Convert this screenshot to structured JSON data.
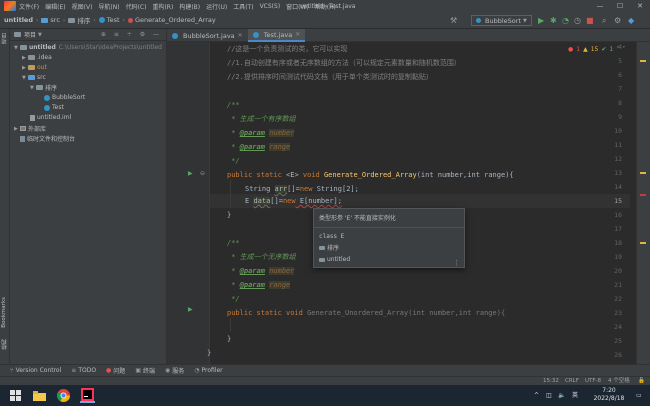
{
  "menubar": {
    "items": [
      "文件(F)",
      "编辑(E)",
      "视图(V)",
      "导航(N)",
      "代码(C)",
      "重构(R)",
      "构建(B)",
      "运行(U)",
      "工具(T)",
      "VCS(S)",
      "窗口(W)",
      "帮助(H)"
    ],
    "title": "untitled - Test.java",
    "min": "—",
    "max": "☐",
    "close": "✕"
  },
  "navbar": {
    "crumbs": [
      "untitled",
      "src",
      "排序",
      "Test",
      "Generate_Ordered_Array"
    ],
    "run_config": "BubbleSort"
  },
  "project": {
    "header": "项目",
    "tree": [
      {
        "label": "untitled",
        "hint": "C:\\Users\\Star\\IdeaProjects\\untitled"
      },
      {
        "label": ".idea"
      },
      {
        "label": "out"
      },
      {
        "label": "src"
      },
      {
        "label": "排序"
      },
      {
        "label": "BubbleSort"
      },
      {
        "label": "Test"
      },
      {
        "label": "untitled.iml"
      },
      {
        "label": "外部库"
      },
      {
        "label": "临时文件和控制台"
      }
    ]
  },
  "left_stripe": {
    "project": "项目",
    "bookmarks": "Bookmarks",
    "structure": "结构"
  },
  "tabs": [
    {
      "label": "BubbleSort.java",
      "active": false
    },
    {
      "label": "Test.java",
      "active": true
    }
  ],
  "inspections": {
    "errors": "1",
    "warnings": "15",
    "ok": "1"
  },
  "editor": {
    "line_numbers": [
      "4",
      "5",
      "6",
      "7",
      "8",
      "9",
      "10",
      "11",
      "12",
      "13",
      "14",
      "15",
      "16",
      "17",
      "18",
      "19",
      "20",
      "21",
      "22",
      "23",
      "24",
      "25",
      "26"
    ],
    "current_line": "15",
    "lines": {
      "l4": "//这是一个负责测试的类，它可以实现",
      "l5": "//1.自动创建有序或者无序数组的方法（可以规定元素数量和随机数范围）",
      "l6": "//2.提供排序时间测试代码文档（用于单个类测试时的复制黏贴）",
      "l8": "/**",
      "l9": " * 生成一个有序数组",
      "l10_tag": "@param",
      "l10_val": "number",
      "l11_tag": "@param",
      "l11_val": "range",
      "l12": " */",
      "l13_kw": "public static",
      "l13_gen": "<E>",
      "l13_void": "void",
      "l13_fn": "Generate_Ordered_Array",
      "l13_params": "(int number,int range){",
      "l14_a": "String",
      "l14_var": "arr",
      "l14_b": "[]=",
      "l14_new": "new",
      "l14_c": " String[2];",
      "l15_a": "E",
      "l15_var": "data",
      "l15_b": "[]=",
      "l15_new": "new",
      "l15_c": " E[number];",
      "l16": "}",
      "l18": "/**",
      "l19": " * 生成一个无序数组",
      "l20_tag": "@param",
      "l20_val": "number",
      "l21_tag": "@param",
      "l21_val": "range",
      "l22": " */",
      "l23_kw": "public static void",
      "l23_fn": "Generate_Unordered_Array",
      "l23_params": "(int number,int range){",
      "l25": "}",
      "l26": "}"
    }
  },
  "popup": {
    "message": "类型形参 'E' 不能直接实例化",
    "line1": "class E",
    "line2": "排序",
    "line3": "untitled",
    "more": "⋮"
  },
  "bottombar": [
    "Version Control",
    "TODO",
    "问题",
    "终端",
    "服务",
    "Profiler"
  ],
  "statusbar": {
    "position": "15:32",
    "line_sep": "CRLF",
    "encoding": "UTF-8",
    "indent": "4 个空格"
  },
  "taskbar": {
    "time": "7:20",
    "date": "2022/8/18",
    "lang": "英",
    "chevron": "^"
  },
  "colors": {
    "accent": "#4a88c7",
    "keyword": "#cc7832",
    "function": "#ffc66d",
    "doc": "#629755"
  }
}
